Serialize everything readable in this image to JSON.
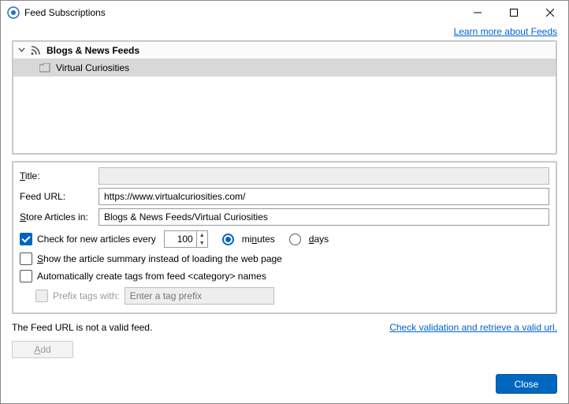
{
  "window": {
    "title": "Feed Subscriptions"
  },
  "helpLink": "Learn more about Feeds",
  "tree": {
    "root": {
      "label": "Blogs & News Feeds"
    },
    "items": [
      {
        "label": "Virtual Curiosities"
      }
    ]
  },
  "form": {
    "titleLabel": "itle:",
    "titleValue": "",
    "feedUrlLabel": "Feed URL:",
    "feedUrlValue": "https://www.virtualcuriosities.com/",
    "storeLabel": "tore Articles in:",
    "storeValue": "Blogs & News Feeds/Virtual Curiosities",
    "checkEvery": {
      "label": "Check for new articles every",
      "value": "100",
      "minutes": "utes",
      "days": "ays"
    },
    "showSummary": "how the article summary instead of loading the web page",
    "autoTags": "Automatically create tags from feed <category> names",
    "prefixLabel": "Prefix tags with:",
    "prefixPlaceholder": "Enter a tag prefix"
  },
  "status": {
    "text": "The Feed URL is not a valid feed.",
    "link": "Check validation and retrieve a valid url."
  },
  "buttons": {
    "add": "dd",
    "close": "Close"
  }
}
